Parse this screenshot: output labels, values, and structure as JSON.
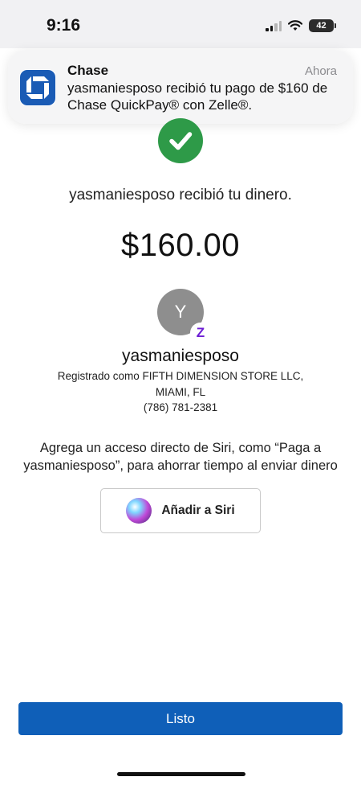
{
  "status_bar": {
    "time": "9:16",
    "battery": "42",
    "icons": [
      "cellular-signal-icon",
      "wifi-icon",
      "battery-icon"
    ]
  },
  "notification": {
    "app": "Chase",
    "time": "Ahora",
    "body": "yasmaniesposo recibió tu pago de $160 de Chase QuickPay® con Zelle®.",
    "icon": "chase-logo-icon",
    "brand_color": "#1a5bb5"
  },
  "confirmation": {
    "icon": "checkmark-icon",
    "color": "#2e9a48",
    "message": "yasmaniesposo recibió tu dinero.",
    "amount": "$160.00"
  },
  "recipient": {
    "avatar_initial": "Y",
    "badge": "Z",
    "name": "yasmaniesposo",
    "registered_line1": "Registrado como FIFTH DIMENSION STORE LLC,",
    "registered_line2": "MIAMI, FL",
    "phone": "(786) 781-2381"
  },
  "siri": {
    "text": "Agrega un acceso directo de Siri, como “Paga a yasmaniesposo”, para ahorrar tiempo al enviar dinero",
    "button_label": "Añadir a Siri"
  },
  "actions": {
    "done_label": "Listo",
    "done_color": "#0f5fb8"
  }
}
